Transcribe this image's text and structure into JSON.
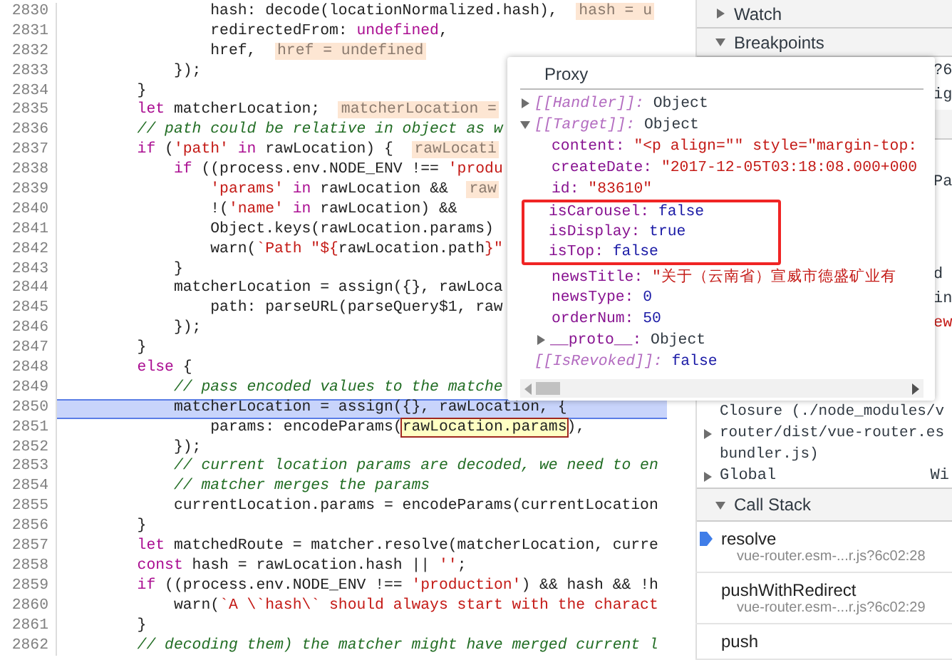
{
  "editor": {
    "lines": [
      {
        "number": "2830",
        "selected": false,
        "segments": [
          {
            "kind": "plain",
            "text": "                hash: decode(locationNormalized.hash),  "
          },
          {
            "kind": "hint",
            "text": "hash = u"
          }
        ]
      },
      {
        "number": "2831",
        "selected": false,
        "segments": [
          {
            "kind": "plain",
            "text": "                redirectedFrom: "
          },
          {
            "kind": "keyword",
            "text": "undefined"
          },
          {
            "kind": "plain",
            "text": ","
          }
        ]
      },
      {
        "number": "2832",
        "selected": false,
        "segments": [
          {
            "kind": "plain",
            "text": "                href,  "
          },
          {
            "kind": "hint",
            "text": "href = undefined"
          }
        ]
      },
      {
        "number": "2833",
        "selected": false,
        "segments": [
          {
            "kind": "plain",
            "text": "            });"
          }
        ]
      },
      {
        "number": "2834",
        "selected": false,
        "segments": [
          {
            "kind": "plain",
            "text": "        }"
          }
        ]
      },
      {
        "number": "2835",
        "selected": false,
        "segments": [
          {
            "kind": "keyword",
            "text": "        let"
          },
          {
            "kind": "plain",
            "text": " matcherLocation;  "
          },
          {
            "kind": "hint",
            "text": "matcherLocation ="
          }
        ]
      },
      {
        "number": "2836",
        "selected": false,
        "segments": [
          {
            "kind": "comment",
            "text": "        // path could be relative in object as w"
          }
        ]
      },
      {
        "number": "2837",
        "selected": false,
        "segments": [
          {
            "kind": "keyword",
            "text": "        if"
          },
          {
            "kind": "plain",
            "text": " ("
          },
          {
            "kind": "string",
            "text": "'path'"
          },
          {
            "kind": "keyword",
            "text": " in"
          },
          {
            "kind": "plain",
            "text": " rawLocation) {  "
          },
          {
            "kind": "hint",
            "text": "rawLocati"
          }
        ]
      },
      {
        "number": "2838",
        "selected": false,
        "segments": [
          {
            "kind": "keyword",
            "text": "            if"
          },
          {
            "kind": "plain",
            "text": " ((process.env.NODE_ENV !== "
          },
          {
            "kind": "string",
            "text": "'produ"
          }
        ]
      },
      {
        "number": "2839",
        "selected": false,
        "segments": [
          {
            "kind": "string",
            "text": "                'params'"
          },
          {
            "kind": "keyword",
            "text": " in"
          },
          {
            "kind": "plain",
            "text": " rawLocation &&  "
          },
          {
            "kind": "hint",
            "text": "raw"
          }
        ]
      },
      {
        "number": "2840",
        "selected": false,
        "segments": [
          {
            "kind": "plain",
            "text": "                !("
          },
          {
            "kind": "string",
            "text": "'name'"
          },
          {
            "kind": "keyword",
            "text": " in"
          },
          {
            "kind": "plain",
            "text": " rawLocation) &&"
          }
        ]
      },
      {
        "number": "2841",
        "selected": false,
        "segments": [
          {
            "kind": "plain",
            "text": "                Object.keys(rawLocation.params)"
          }
        ]
      },
      {
        "number": "2842",
        "selected": false,
        "segments": [
          {
            "kind": "plain",
            "text": "                warn("
          },
          {
            "kind": "string",
            "text": "`Path \"${"
          },
          {
            "kind": "plain",
            "text": "rawLocation.path"
          },
          {
            "kind": "string",
            "text": "}\""
          }
        ]
      },
      {
        "number": "2843",
        "selected": false,
        "segments": [
          {
            "kind": "plain",
            "text": "            }"
          }
        ]
      },
      {
        "number": "2844",
        "selected": false,
        "segments": [
          {
            "kind": "plain",
            "text": "            matcherLocation = assign({}, rawLoca"
          }
        ]
      },
      {
        "number": "2845",
        "selected": false,
        "segments": [
          {
            "kind": "plain",
            "text": "                path: parseURL(parseQuery$1, raw"
          }
        ]
      },
      {
        "number": "2846",
        "selected": false,
        "segments": [
          {
            "kind": "plain",
            "text": "            });"
          }
        ]
      },
      {
        "number": "2847",
        "selected": false,
        "segments": [
          {
            "kind": "plain",
            "text": "        }"
          }
        ]
      },
      {
        "number": "2848",
        "selected": false,
        "segments": [
          {
            "kind": "keyword",
            "text": "        else"
          },
          {
            "kind": "plain",
            "text": " {"
          }
        ]
      },
      {
        "number": "2849",
        "selected": false,
        "segments": [
          {
            "kind": "comment",
            "text": "            // pass encoded values to the matche"
          }
        ]
      },
      {
        "number": "2850",
        "selected": true,
        "segments": [
          {
            "kind": "plain",
            "text": "            matcherLocation = assign({}, rawLocation, {"
          }
        ]
      },
      {
        "number": "2851",
        "selected": false,
        "segments": [
          {
            "kind": "plain",
            "text": "                params: encodeParams("
          },
          {
            "kind": "evaluated",
            "text": "rawLocation.params"
          },
          {
            "kind": "plain",
            "text": "),"
          }
        ]
      },
      {
        "number": "2852",
        "selected": false,
        "segments": [
          {
            "kind": "plain",
            "text": "            });"
          }
        ]
      },
      {
        "number": "2853",
        "selected": false,
        "segments": [
          {
            "kind": "comment",
            "text": "            // current location params are decoded, we need to en"
          }
        ]
      },
      {
        "number": "2854",
        "selected": false,
        "segments": [
          {
            "kind": "comment",
            "text": "            // matcher merges the params"
          }
        ]
      },
      {
        "number": "2855",
        "selected": false,
        "segments": [
          {
            "kind": "plain",
            "text": "            currentLocation.params = encodeParams(currentLocation"
          }
        ]
      },
      {
        "number": "2856",
        "selected": false,
        "segments": [
          {
            "kind": "plain",
            "text": "        }"
          }
        ]
      },
      {
        "number": "2857",
        "selected": false,
        "segments": [
          {
            "kind": "keyword",
            "text": "        let"
          },
          {
            "kind": "plain",
            "text": " matchedRoute = matcher.resolve(matcherLocation, curre"
          }
        ]
      },
      {
        "number": "2858",
        "selected": false,
        "segments": [
          {
            "kind": "keyword",
            "text": "        const"
          },
          {
            "kind": "plain",
            "text": " hash = rawLocation.hash || "
          },
          {
            "kind": "string",
            "text": "''"
          },
          {
            "kind": "plain",
            "text": ";"
          }
        ]
      },
      {
        "number": "2859",
        "selected": false,
        "segments": [
          {
            "kind": "keyword",
            "text": "        if"
          },
          {
            "kind": "plain",
            "text": " ((process.env.NODE_ENV !== "
          },
          {
            "kind": "string",
            "text": "'production'"
          },
          {
            "kind": "plain",
            "text": ") && hash && !h"
          }
        ]
      },
      {
        "number": "2860",
        "selected": false,
        "segments": [
          {
            "kind": "plain",
            "text": "            warn("
          },
          {
            "kind": "string",
            "text": "`A \\`hash\\` should always start with the charact"
          }
        ]
      },
      {
        "number": "2861",
        "selected": false,
        "segments": [
          {
            "kind": "plain",
            "text": "        }"
          }
        ]
      },
      {
        "number": "2862",
        "selected": false,
        "segments": [
          {
            "kind": "comment",
            "text": "        // decoding them) the matcher might have merged current l"
          }
        ]
      }
    ]
  },
  "sidebar": {
    "watch": {
      "title": "Watch",
      "expanded": false
    },
    "breakpoints": {
      "title": "Breakpoints",
      "expanded": true,
      "fragments": [
        {
          "text": "?6",
          "kind": "plain"
        },
        {
          "text": "ig",
          "kind": "plain"
        }
      ]
    },
    "scope": {
      "fragments": [
        {
          "text": "Pa",
          "kind": "plain"
        },
        {
          "text": "d",
          "kind": "plain"
        },
        {
          "text": "in",
          "kind": "plain"
        },
        {
          "text": "ew",
          "kind": "string"
        }
      ],
      "closure": {
        "lines": [
          "Closure (./node_modules/v",
          "router/dist/vue-router.es",
          "bundler.js)"
        ],
        "expanded": false
      },
      "global": {
        "name": "Global",
        "value": "Wi",
        "expanded": false
      }
    },
    "call_stack": {
      "title": "Call Stack",
      "expanded": true,
      "frames": [
        {
          "name": "resolve",
          "location": "vue-router.esm-...r.js?6c02:28",
          "selected": true
        },
        {
          "name": "pushWithRedirect",
          "location": "vue-router.esm-...r.js?6c02:29",
          "selected": false
        },
        {
          "name": "push",
          "selected": false
        }
      ]
    }
  },
  "popover": {
    "title": "Proxy",
    "entries": [
      {
        "key": "[[Handler]]:",
        "value": "Object",
        "kind": "object",
        "internal": true,
        "expanded": false
      },
      {
        "key": "[[Target]]:",
        "value": "Object",
        "kind": "object",
        "internal": true,
        "expanded": true,
        "children": [
          {
            "key": "content:",
            "value": "\"<p align=\"\" style=\"margin-top:",
            "kind": "string",
            "internal": false,
            "highlighted": false
          },
          {
            "key": "createDate:",
            "value": "\"2017-12-05T03:18:08.000+000",
            "kind": "string",
            "internal": false,
            "highlighted": false
          },
          {
            "key": "id:",
            "value": "\"83610\"",
            "kind": "string",
            "internal": false,
            "highlighted": false
          },
          {
            "key": "isCarousel:",
            "value": "false",
            "kind": "boolean",
            "internal": false,
            "highlighted": true
          },
          {
            "key": "isDisplay:",
            "value": "true",
            "kind": "boolean",
            "internal": false,
            "highlighted": true
          },
          {
            "key": "isTop:",
            "value": "false",
            "kind": "boolean",
            "internal": false,
            "highlighted": true
          },
          {
            "key": "newsTitle:",
            "value": "\"关于（云南省）宣威市德盛矿业有",
            "kind": "string",
            "internal": false,
            "highlighted": false
          },
          {
            "key": "newsType:",
            "value": "0",
            "kind": "number",
            "internal": false,
            "highlighted": false
          },
          {
            "key": "orderNum:",
            "value": "50",
            "kind": "number",
            "internal": false,
            "highlighted": false
          },
          {
            "key": "__proto__:",
            "value": "Object",
            "kind": "object",
            "internal": false,
            "expanded": false,
            "highlighted": false
          }
        ]
      },
      {
        "key": "[[IsRevoked]]:",
        "value": "false",
        "kind": "boolean",
        "internal": true
      }
    ]
  }
}
